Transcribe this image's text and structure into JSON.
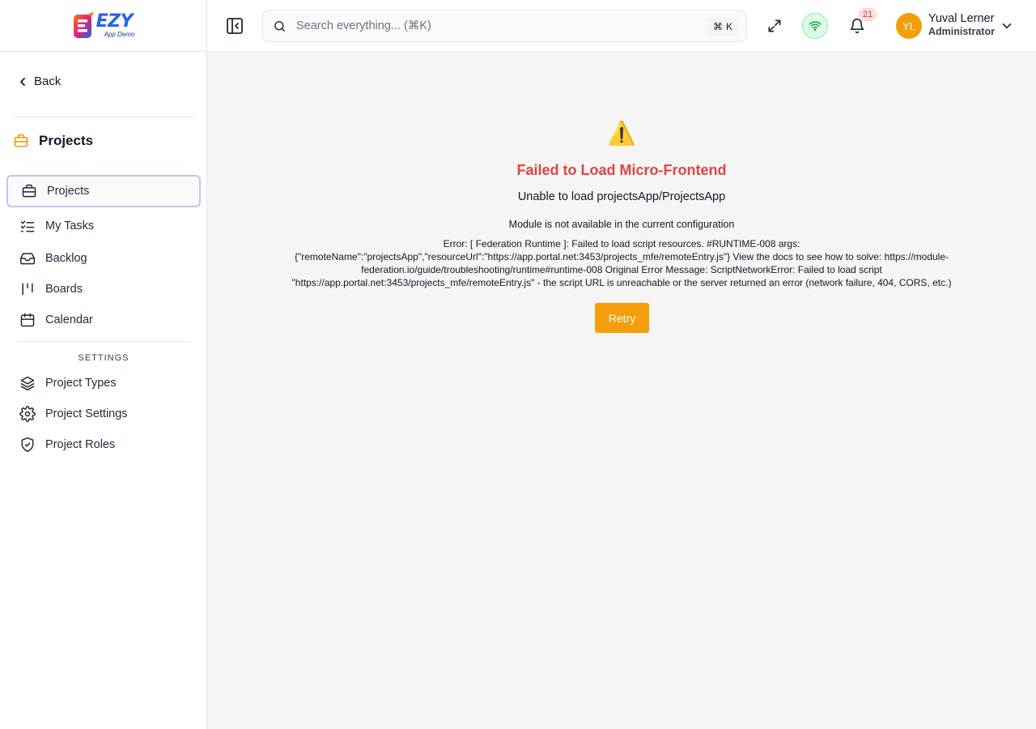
{
  "app": {
    "logo_word": "EZY",
    "logo_sub": "App Demo"
  },
  "sidebar": {
    "back_label": "Back",
    "section_title": "Projects",
    "items": [
      {
        "label": "Projects",
        "icon": "briefcase-icon",
        "active": true
      },
      {
        "label": "My Tasks",
        "icon": "list-checks-icon"
      },
      {
        "label": "Backlog",
        "icon": "inbox-icon"
      },
      {
        "label": "Boards",
        "icon": "kanban-icon"
      },
      {
        "label": "Calendar",
        "icon": "calendar-icon"
      }
    ],
    "settings_label": "SETTINGS",
    "settings_items": [
      {
        "label": "Project Types",
        "icon": "layers-icon"
      },
      {
        "label": "Project Settings",
        "icon": "gear-icon"
      },
      {
        "label": "Project Roles",
        "icon": "shield-check-icon"
      }
    ]
  },
  "header": {
    "search_placeholder": "Search everything... (⌘K)",
    "search_value": "",
    "shortcut_symbol": "⌘",
    "shortcut_key": "K",
    "notification_count": "21",
    "user": {
      "initials": "YL",
      "name": "Yuval Lerner",
      "role": "Administrator"
    },
    "colors": {
      "accent": "#f59e0b",
      "online": "#16a34a",
      "badge": "#dc2626"
    }
  },
  "main": {
    "error_icon": "⚠️",
    "error_title": "Failed to Load Micro-Frontend",
    "error_subtitle": "Unable to load projectsApp/ProjectsApp",
    "error_module": "Module is not available in the current configuration",
    "error_detail": "Error: [ Federation Runtime ]: Failed to load script resources. #RUNTIME-008 args: {\"remoteName\":\"projectsApp\",\"resourceUrl\":\"https://app.portal.net:3453/projects_mfe/remoteEntry.js\"} View the docs to see how to solve: https://module-federation.io/guide/troubleshooting/runtime#runtime-008 Original Error Message: ScriptNetworkError: Failed to load script \"https://app.portal.net:3453/projects_mfe/remoteEntry.js\" - the script URL is unreachable or the server returned an error (network failure, 404, CORS, etc.)",
    "retry_label": "Retry",
    "colors": {
      "error": "#e04444"
    }
  }
}
